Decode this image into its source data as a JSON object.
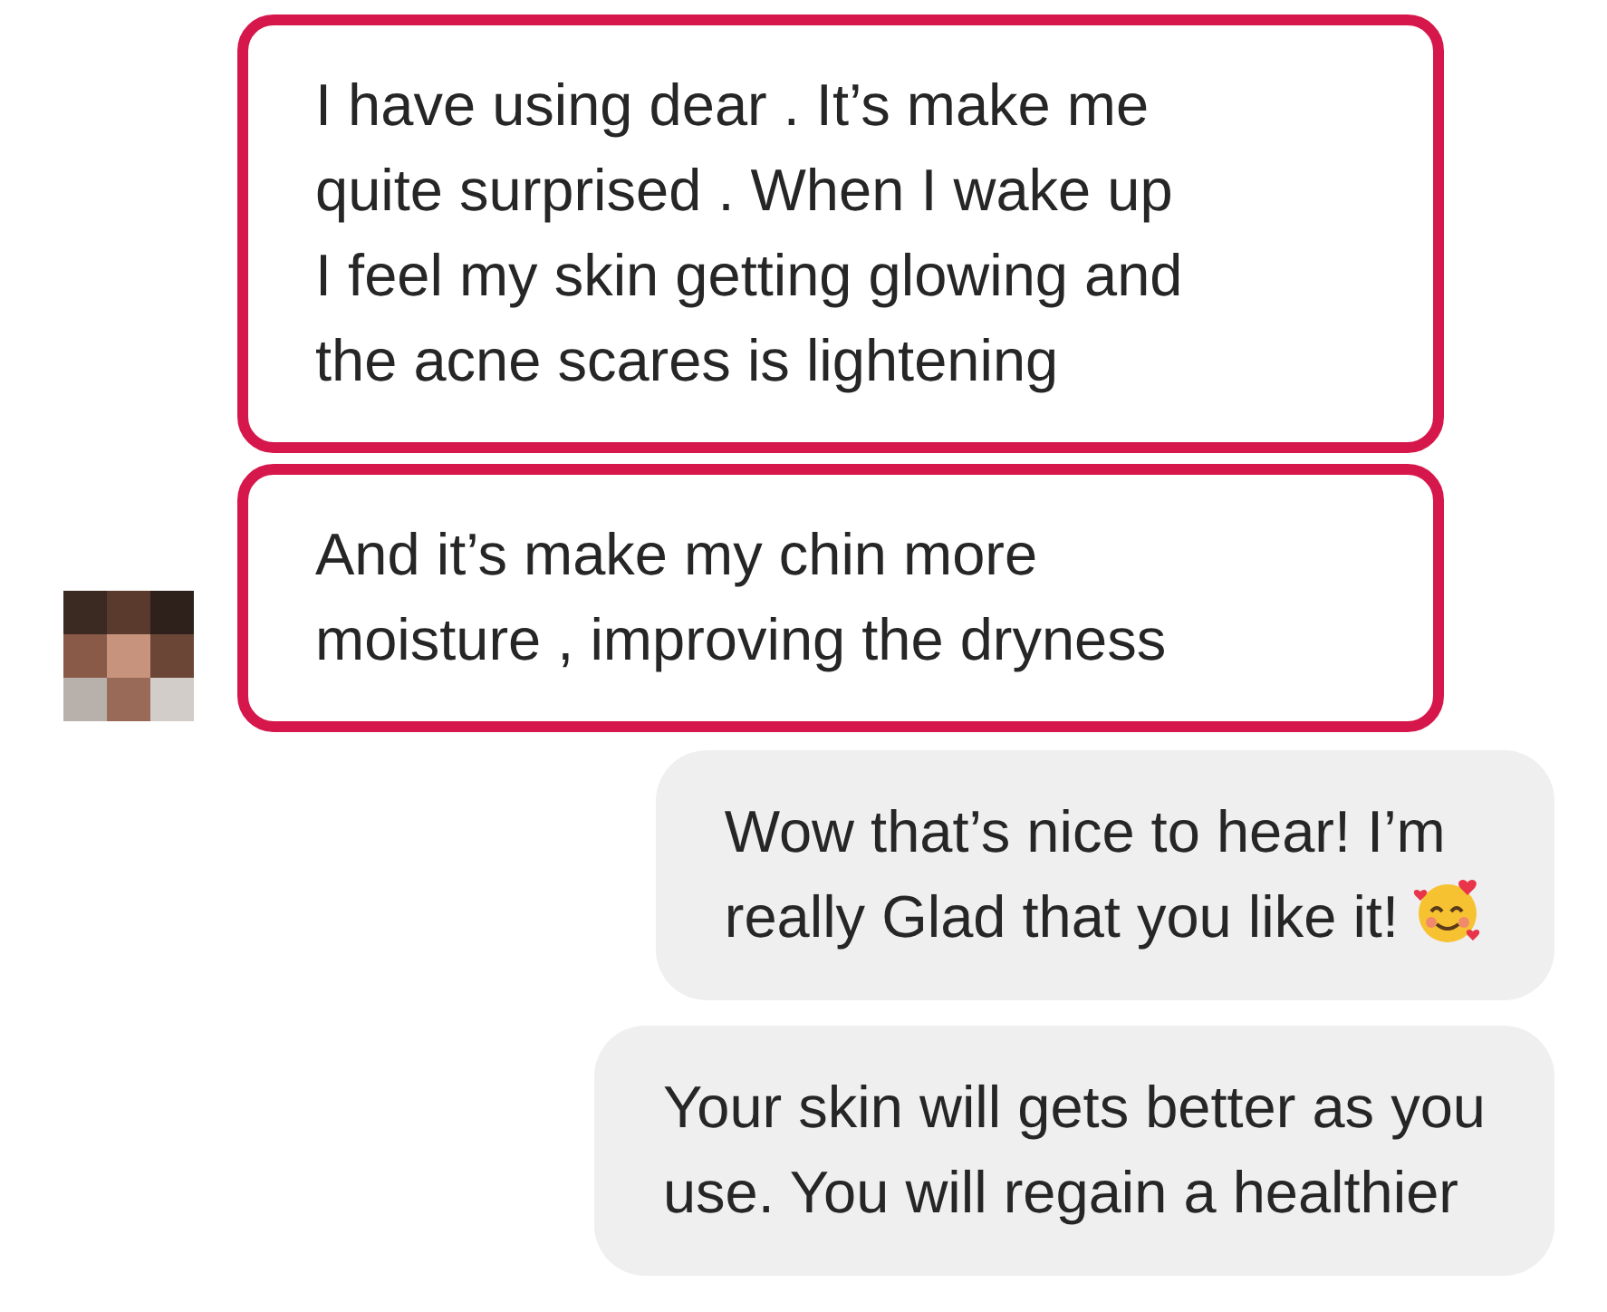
{
  "messages": [
    {
      "kind": "incoming",
      "text": "I have using dear . It’s make me\nquite surprised . When I wake up\nI feel my skin getting glowing and\nthe acne scares is lightening",
      "highlighted": true,
      "emoji": false
    },
    {
      "kind": "incoming",
      "text": "And it’s make my chin more\nmoisture , improving the dryness",
      "highlighted": true,
      "emoji": false
    },
    {
      "kind": "outgoing",
      "text": "Wow that’s nice to hear! I’m\nreally Glad that you like it!",
      "highlighted": false,
      "emoji": true
    },
    {
      "kind": "outgoing",
      "text": "Your skin will gets better as you\nuse. You will regain a healthier",
      "highlighted": false,
      "emoji": false
    }
  ]
}
